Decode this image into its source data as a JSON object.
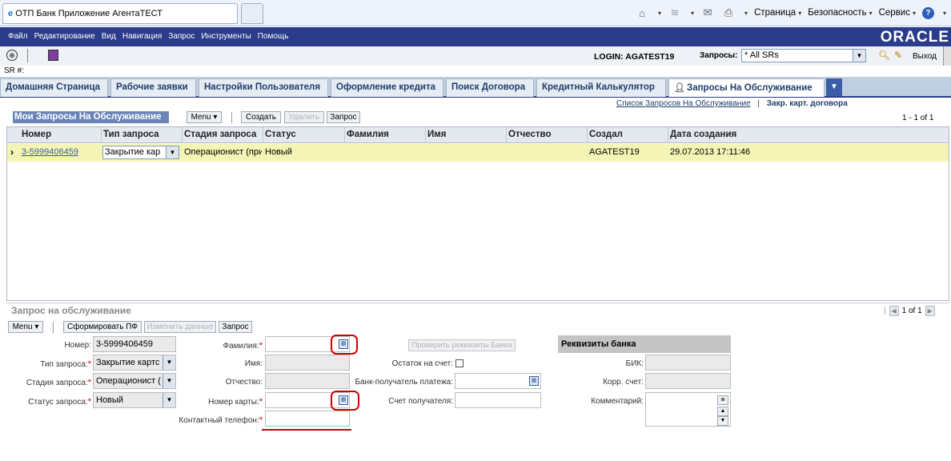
{
  "browser": {
    "tab_title": "ОТП Банк Приложение АгентаТЕСТ",
    "tools": {
      "page": "Страница",
      "security": "Безопасность",
      "service": "Сервис"
    }
  },
  "menubar": {
    "items": [
      "Файл",
      "Редактирование",
      "Вид",
      "Навигация",
      "Запрос",
      "Инструменты",
      "Помощь"
    ],
    "brand": "ORACLE"
  },
  "toolbar": {
    "login": "LOGIN: AGATEST19",
    "queries_label": "Запросы:",
    "queries_value": "* All SRs",
    "logout": "Выход"
  },
  "sr_line": "SR #:",
  "tabs": [
    "Домашняя Страница",
    "Рабочие заявки",
    "Настройки Пользователя",
    "Оформление кредита",
    "Поиск Договора",
    "Кредитный Калькулятор",
    "Запросы На Обслуживание"
  ],
  "subtabs": {
    "link": "Список Запросов На Обслуживание",
    "current": "Закр. карт. договора"
  },
  "list": {
    "title": "Мои Запросы На Обслуживание",
    "buttons": {
      "menu": "Menu ▾",
      "create": "Создать",
      "delete": "Удалить",
      "query": "Запрос"
    },
    "record_count": "1 - 1 of 1",
    "columns": [
      "Номер",
      "Тип запроса",
      "Стадия запроса",
      "Статус",
      "Фамилия",
      "Имя",
      "Отчество",
      "Создал",
      "Дата создания"
    ],
    "row": {
      "number": "3-5999406459",
      "type": "Закрытие кар",
      "stage": "Операционист (при",
      "status": "Новый",
      "created_by": "AGATEST19",
      "created_at": "29.07.2013 17:11:46"
    }
  },
  "form": {
    "title": "Запрос на обслуживание",
    "pager": "1 of 1",
    "buttons": {
      "menu": "Menu ▾",
      "generate": "Сформировать ПФ",
      "change": "Изменить данные",
      "query": "Запрос"
    },
    "labels": {
      "number": "Номер:",
      "type": "Тип запроса:",
      "stage": "Стадия запроса:",
      "status": "Статус запроса:",
      "surname": "Фамилия:",
      "name": "Имя:",
      "patronymic": "Отчество:",
      "card_number": "Номер карты:",
      "phone": "Контактный телефон:",
      "check_bank": "Проверить реквизиты Банка",
      "balance": "Остаток на счет:",
      "bank_recipient": "Банк-получатель платежа:",
      "recipient_account": "Счет получателя:",
      "bank_details": "Реквизиты банка",
      "bik": "БИК:",
      "corr_account": "Корр. счет:",
      "comment": "Комментарий:"
    },
    "values": {
      "number": "3-5999406459",
      "type": "Закрытие картс",
      "stage": "Операционист (",
      "status": "Новый"
    }
  }
}
